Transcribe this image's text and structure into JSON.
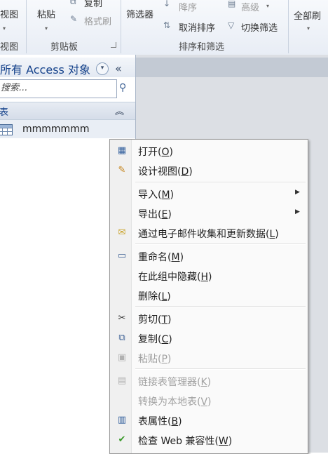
{
  "ribbon": {
    "view_partial": "视图",
    "view_label": "视图",
    "paste": "粘贴",
    "copy": "复制",
    "format_painter": "格式刷",
    "clipboard_group": "剪贴板",
    "filter": "筛选器",
    "descending": "降序",
    "advanced": "高级",
    "clear_sort": "取消排序",
    "toggle_filter": "切换筛选",
    "sort_filter_group": "排序和筛选",
    "refresh_all": "全部刷"
  },
  "nav": {
    "title": "所有 Access 对象",
    "search_placeholder": "搜索...",
    "group_label": "表",
    "table_name": "mmmmmmm"
  },
  "context_menu": {
    "open": {
      "label": "打开(",
      "key": "O",
      "end": ")"
    },
    "design_view": {
      "label": "设计视图(",
      "key": "D",
      "end": ")"
    },
    "import": {
      "label": "导入(",
      "key": "M",
      "end": ")"
    },
    "export": {
      "label": "导出(",
      "key": "E",
      "end": ")"
    },
    "email_collect": {
      "label": "通过电子邮件收集和更新数据(",
      "key": "L",
      "end": ")"
    },
    "rename": {
      "label": "重命名(",
      "key": "M",
      "end": ")"
    },
    "hide": {
      "label": "在此组中隐藏(",
      "key": "H",
      "end": ")"
    },
    "delete": {
      "label": "删除(",
      "key": "L",
      "end": ")"
    },
    "cut": {
      "label": "剪切(",
      "key": "T",
      "end": ")"
    },
    "copy": {
      "label": "复制(",
      "key": "C",
      "end": ")"
    },
    "paste": {
      "label": "粘贴(",
      "key": "P",
      "end": ")"
    },
    "link_manager": {
      "label": "链接表管理器(",
      "key": "K",
      "end": ")"
    },
    "convert_local": {
      "label": "转换为本地表(",
      "key": "V",
      "end": ")"
    },
    "properties": {
      "label": "表属性(",
      "key": "B",
      "end": ")"
    },
    "web_check": {
      "label": "检查 Web 兼容性(",
      "key": "W",
      "end": ")"
    }
  }
}
